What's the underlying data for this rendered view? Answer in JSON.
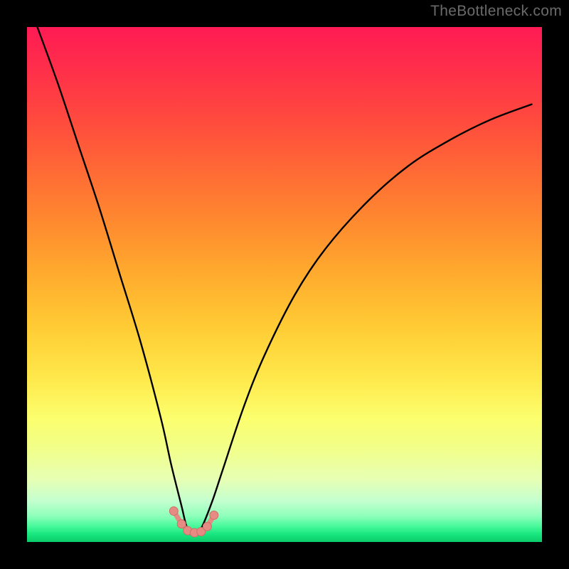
{
  "watermark": "TheBottleneck.com",
  "colors": {
    "frame_bg": "#000000",
    "gradient_top": "#ff1b54",
    "gradient_bottom": "#0acc6a",
    "curve": "#000000",
    "markers_fill": "#e58b84",
    "markers_stroke": "#cf6e66"
  },
  "chart_data": {
    "type": "line",
    "title": "",
    "xlabel": "",
    "ylabel": "",
    "xlim": [
      0,
      100
    ],
    "ylim": [
      0,
      100
    ],
    "grid": false,
    "legend": false,
    "series": [
      {
        "name": "bottleneck-curve",
        "comment": "V-shaped curve with a minimum around x≈31-34, y≈2. Left branch steeper than right.",
        "x": [
          2,
          6,
          10,
          14,
          18,
          22,
          26,
          28,
          30,
          31,
          32,
          33,
          34,
          36,
          38,
          42,
          46,
          52,
          58,
          66,
          74,
          82,
          90,
          98
        ],
        "y": [
          100,
          89,
          77,
          65,
          52,
          39,
          24,
          15,
          7,
          3,
          2,
          2,
          3,
          8,
          14,
          26,
          36,
          48,
          57,
          66,
          73,
          78,
          82,
          85
        ]
      },
      {
        "name": "trough-markers",
        "comment": "Salmon connected dots near the minimum of the curve.",
        "x": [
          28.5,
          30.0,
          31.2,
          32.5,
          33.8,
          35.0,
          36.3
        ],
        "y": [
          6.0,
          3.5,
          2.2,
          1.8,
          2.0,
          3.0,
          5.2
        ]
      }
    ]
  }
}
